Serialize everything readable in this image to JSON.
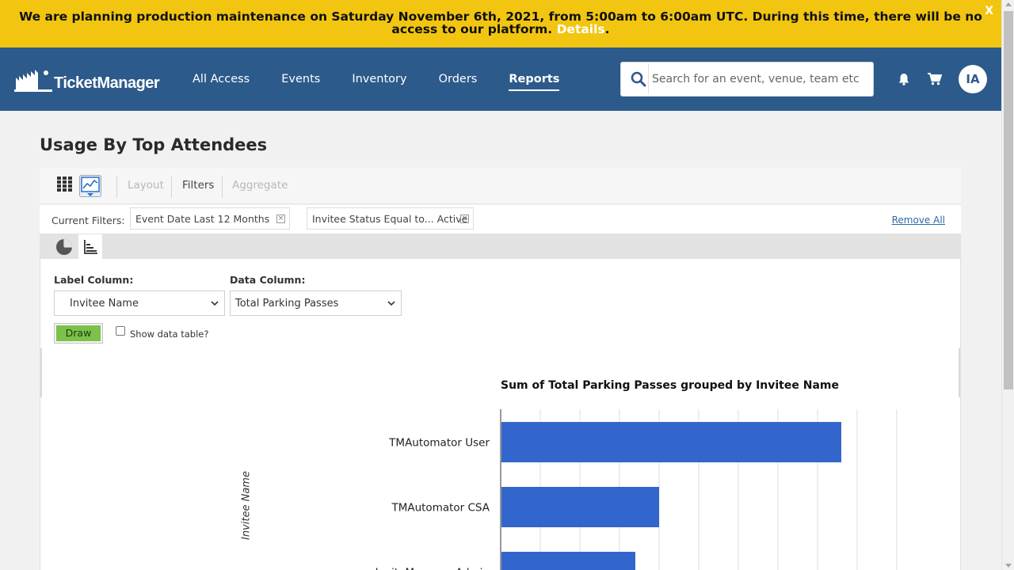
{
  "banner": {
    "message": "We are planning production maintenance on Saturday November 6th, 2021, from 5:00am to 6:00am UTC. During this time, there will be no access to our platform.",
    "details_link": "Details",
    "period": ".",
    "close": "X"
  },
  "nav": {
    "logo_text": "TicketManager",
    "links": [
      "All Access",
      "Events",
      "Inventory",
      "Orders",
      "Reports"
    ],
    "active_link": "Reports",
    "search_placeholder": "Search for an event, venue, team etc",
    "avatar_initials": "IA",
    "color": "#2c5a8b"
  },
  "page": {
    "title": "Usage By Top Attendees"
  },
  "toolbar": {
    "layout": "Layout",
    "filters": "Filters",
    "aggregate": "Aggregate"
  },
  "filters": {
    "label": "Current Filters:",
    "chips": [
      "Event Date Last 12 Months",
      "Invitee Status Equal to... Active"
    ],
    "remove_all": "Remove All"
  },
  "chart_form": {
    "label_column_label": "Label Column:",
    "label_column_value": "Invitee Name",
    "data_column_label": "Data Column:",
    "data_column_value": "Total Parking Passes",
    "draw_button": "Draw",
    "show_table_label": "Show data table?"
  },
  "chart_data": {
    "type": "bar",
    "orientation": "horizontal",
    "title": "Sum of Total Parking Passes grouped by Invitee Name",
    "ylabel": "Invitee Name",
    "xlabel": "",
    "categories": [
      "TMAutomator User",
      "TMAutomator CSA",
      "InviteManager Admin"
    ],
    "values": [
      8.6,
      4,
      3.4
    ],
    "xlim": [
      0,
      10
    ],
    "grid": true,
    "bar_color": "#3366cc"
  }
}
